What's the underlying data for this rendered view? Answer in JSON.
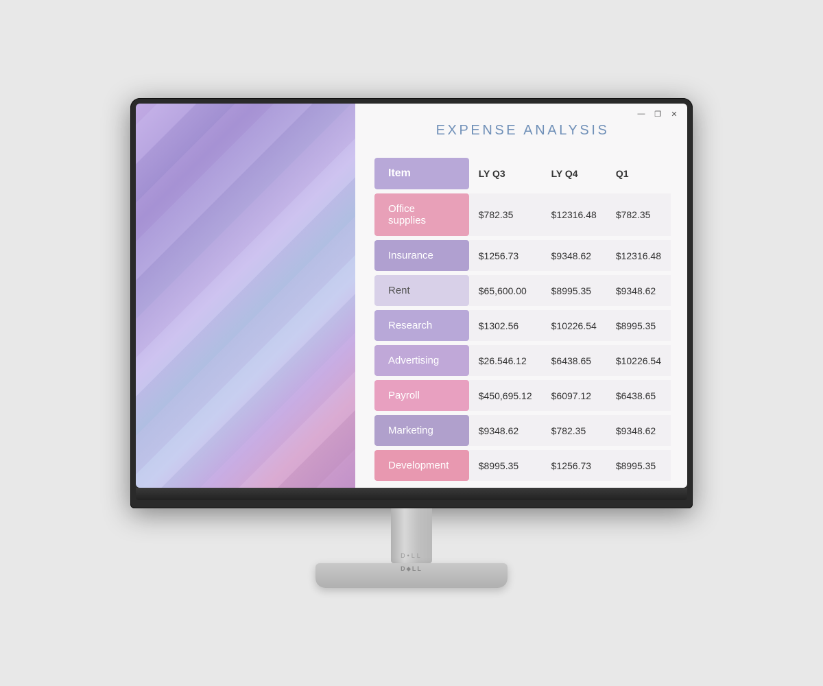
{
  "titlebar": {
    "minimize": "—",
    "restore": "❐",
    "close": "✕"
  },
  "table": {
    "title": "EXPENSE ANALYSIS",
    "headers": [
      "Item",
      "LY Q3",
      "LY Q4",
      "Q1"
    ],
    "rows": [
      {
        "item": "Office supplies",
        "lyq3": "$782.35",
        "lyq4": "$12316.48",
        "q1": "$782.35",
        "style": "row-pink"
      },
      {
        "item": "Insurance",
        "lyq3": "$1256.73",
        "lyq4": "$9348.62",
        "q1": "$12316.48",
        "style": "row-purple"
      },
      {
        "item": "Rent",
        "lyq3": "$65,600.00",
        "lyq4": "$8995.35",
        "q1": "$9348.62",
        "style": "row-light"
      },
      {
        "item": "Research",
        "lyq3": "$1302.56",
        "lyq4": "$10226.54",
        "q1": "$8995.35",
        "style": "row-purple2"
      },
      {
        "item": "Advertising",
        "lyq3": "$26.546.12",
        "lyq4": "$6438.65",
        "q1": "$10226.54",
        "style": "row-purple3"
      },
      {
        "item": "Payroll",
        "lyq3": "$450,695.12",
        "lyq4": "$6097.12",
        "q1": "$6438.65",
        "style": "row-pink2"
      },
      {
        "item": "Marketing",
        "lyq3": "$9348.62",
        "lyq4": "$782.35",
        "q1": "$9348.62",
        "style": "row-purple4"
      },
      {
        "item": "Development",
        "lyq3": "$8995.35",
        "lyq4": "$1256.73",
        "q1": "$8995.35",
        "style": "row-pink3"
      }
    ]
  }
}
